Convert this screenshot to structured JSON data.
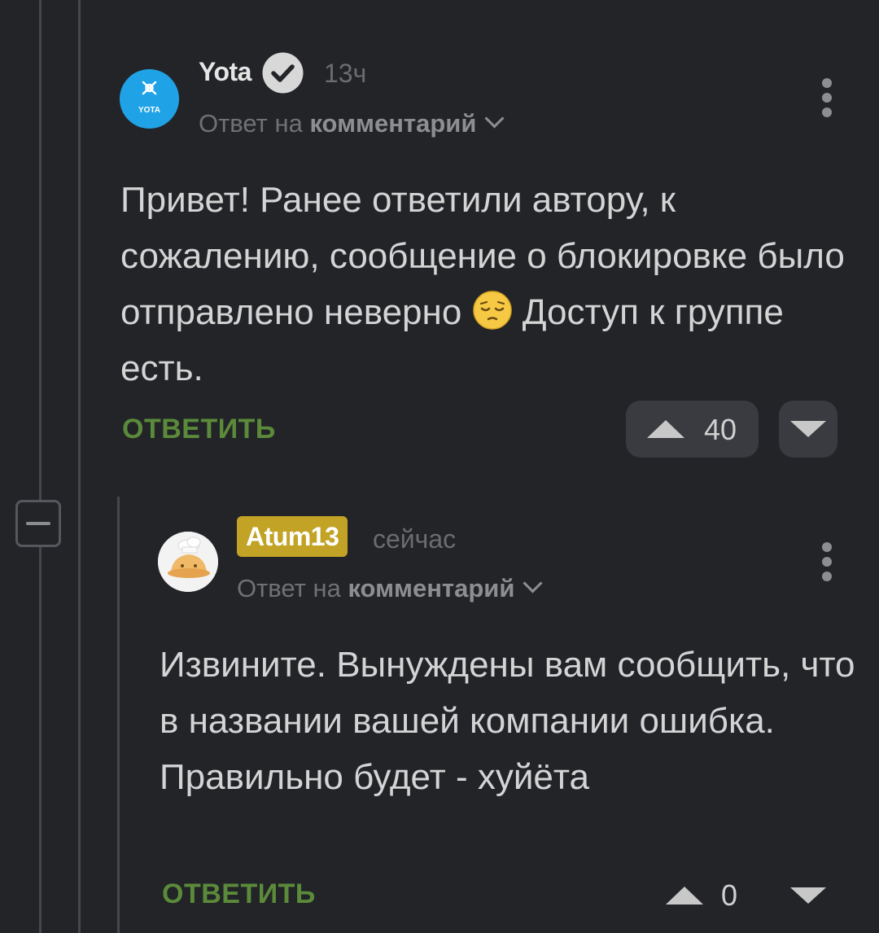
{
  "theme": {
    "background": "#222428",
    "accent_green": "#5b8a3a",
    "badge_gold": "#c2a326",
    "logo_blue": "#1fa3e6"
  },
  "comments": [
    {
      "author": "Yota",
      "avatar_text": "YOTA",
      "verified": true,
      "time": "13ч",
      "reply_prefix": "Ответ на",
      "reply_target": "комментарий",
      "text_before_emoji": "Привет! Ранее ответили автору, к сожалению, сообщение о блокировке было отправлено неверно",
      "emoji": "pensive-face",
      "text_after_emoji": " Доступ к группе есть.",
      "reply_label": "ОТВЕТИТЬ",
      "rating": "40"
    },
    {
      "author": "Atum13",
      "time": "сейчас",
      "reply_prefix": "Ответ на",
      "reply_target": "комментарий",
      "text": "Извините. Вынуждены вам сообщить, что в названии вашей компании ошибка. Правильно будет - хуйёта",
      "reply_label": "ОТВЕТИТЬ",
      "rating": "0"
    }
  ]
}
